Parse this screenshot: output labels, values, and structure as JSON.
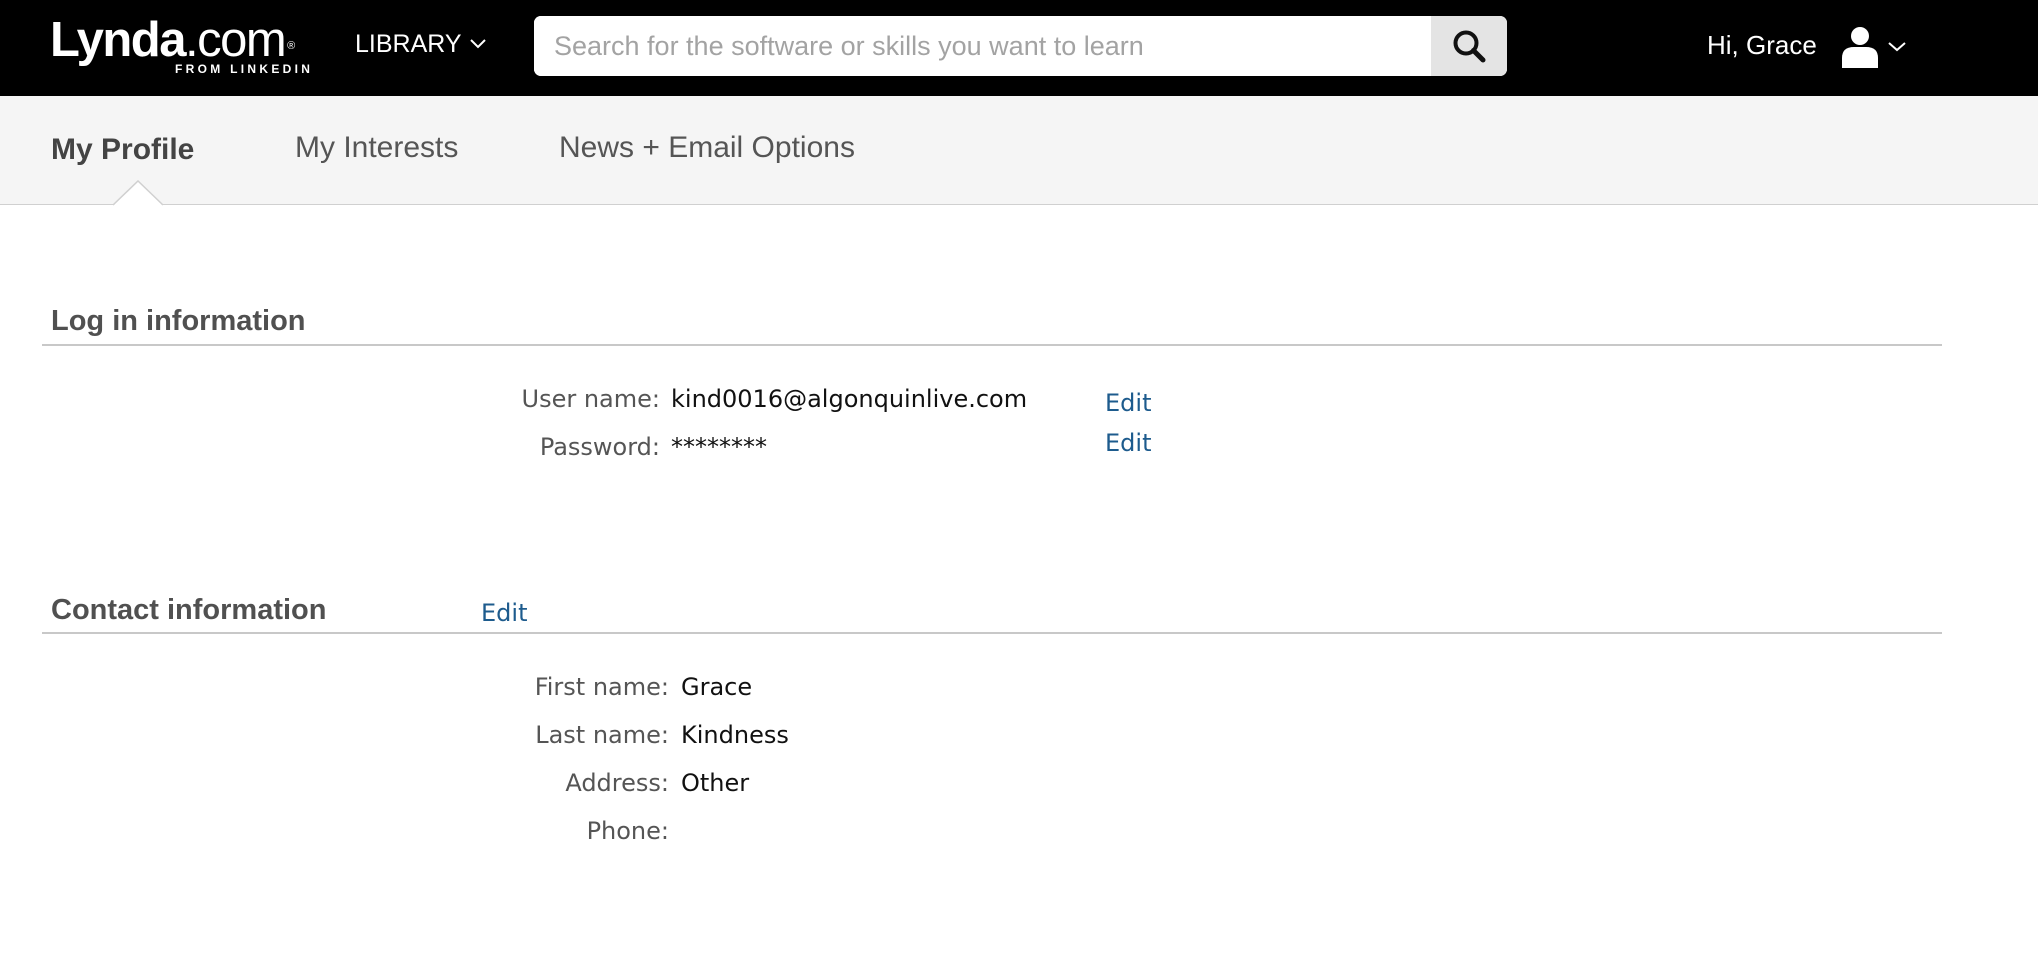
{
  "header": {
    "logo": {
      "wordmark_bold": "Lynda",
      "wordmark_light": ".com",
      "registered": "®",
      "tagline": "FROM LINKEDIN"
    },
    "library_label": "LIBRARY",
    "search": {
      "placeholder": "Search for the software or skills you want to learn",
      "value": "",
      "button_icon": "search-icon"
    },
    "greeting": "Hi, Grace",
    "user_icon": "user-icon"
  },
  "tabs": [
    {
      "label": "My Profile",
      "active": true
    },
    {
      "label": "My Interests",
      "active": false
    },
    {
      "label": "News + Email Options",
      "active": false
    }
  ],
  "login_section": {
    "title": "Log in information",
    "fields": [
      {
        "label": "User name:",
        "value": "kind0016@algonquinlive.com",
        "edit_label": "Edit"
      },
      {
        "label": "Password:",
        "value": "********",
        "edit_label": "Edit"
      }
    ]
  },
  "contact_section": {
    "title": "Contact information",
    "edit_label": "Edit",
    "fields": [
      {
        "label": "First name:",
        "value": "Grace"
      },
      {
        "label": "Last name:",
        "value": "Kindness"
      },
      {
        "label": "Address:",
        "value": "Other"
      },
      {
        "label": "Phone:",
        "value": ""
      }
    ]
  },
  "colors": {
    "header_bg": "#000000",
    "tabbar_bg": "#f5f5f5",
    "link": "#1d5b8d",
    "heading": "#505050"
  }
}
